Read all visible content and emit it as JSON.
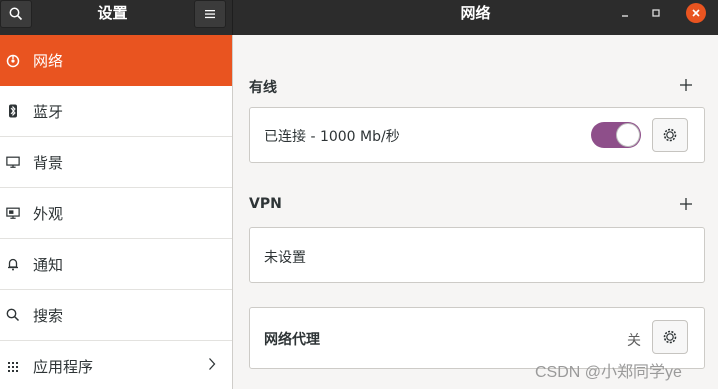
{
  "window": {
    "sidebar_title": "设置",
    "main_title": "网络"
  },
  "sidebar": {
    "items": [
      {
        "label": "网络",
        "icon": "network-icon",
        "active": true
      },
      {
        "label": "蓝牙",
        "icon": "bluetooth-icon"
      },
      {
        "label": "背景",
        "icon": "background-icon"
      },
      {
        "label": "外观",
        "icon": "appearance-icon"
      },
      {
        "label": "通知",
        "icon": "bell-icon"
      },
      {
        "label": "搜索",
        "icon": "search-icon"
      },
      {
        "label": "应用程序",
        "icon": "apps-icon",
        "has_arrow": true
      }
    ]
  },
  "main": {
    "wired": {
      "title": "有线",
      "connection_label": "已连接 - 1000 Mb/秒",
      "toggle_on": true
    },
    "vpn": {
      "title": "VPN",
      "status": "未设置"
    },
    "proxy": {
      "label": "网络代理",
      "status": "关"
    }
  },
  "watermark": "CSDN @小郑同学ye",
  "colors": {
    "accent": "#e95420",
    "toggle": "#8e4f8a",
    "headerbar": "#2c2c2c"
  }
}
